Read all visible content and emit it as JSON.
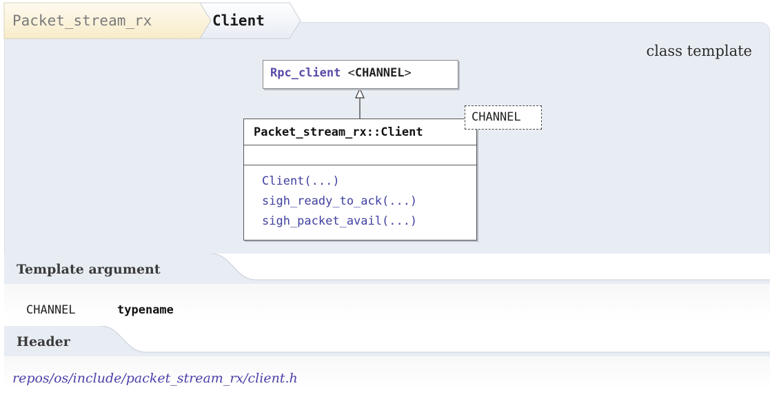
{
  "breadcrumb": {
    "items": [
      {
        "label": "Packet_stream_rx"
      },
      {
        "label": "Client"
      }
    ]
  },
  "kind_label": "class template",
  "diagram": {
    "base_class": {
      "name": "Rpc_client",
      "template_prefix": "<",
      "template_arg": "CHANNEL",
      "template_suffix": ">"
    },
    "class": {
      "title": "Packet_stream_rx::Client",
      "operations": [
        {
          "label": "Client(...)"
        },
        {
          "label": "sigh_ready_to_ack(...)"
        },
        {
          "label": "sigh_packet_avail(...)"
        }
      ]
    },
    "template_parameter": "CHANNEL"
  },
  "template_argument_section": {
    "title": "Template argument",
    "args": [
      {
        "name": "CHANNEL",
        "type": "typename"
      }
    ]
  },
  "header_section": {
    "title": "Header",
    "path": "repos/os/include/packet_stream_rx/client.h"
  },
  "colors": {
    "panel_bg": "#e8ecf3",
    "breadcrumb_first_bg": "#fdf6e0",
    "breadcrumb_second_bg": "#e8ecf3",
    "link": "#4a3fa8",
    "base_name": "#5b49a8",
    "operation": "#4040a0"
  }
}
